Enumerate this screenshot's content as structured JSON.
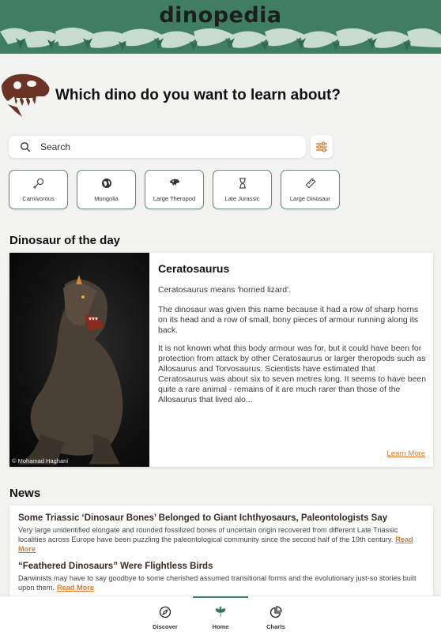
{
  "app": {
    "logo_text": "dinopedia"
  },
  "hero": {
    "title": "Which dino do you want to learn about?"
  },
  "search": {
    "placeholder": "Search",
    "value": ""
  },
  "chips": [
    {
      "label": "Carnivorous",
      "icon": "drumstick-icon"
    },
    {
      "label": "Mongolia",
      "icon": "globe-icon"
    },
    {
      "label": "Large Theropod",
      "icon": "dino-head-icon"
    },
    {
      "label": "Late Jurassic",
      "icon": "hourglass-icon"
    },
    {
      "label": "Large Dinosaur",
      "icon": "ruler-icon"
    }
  ],
  "dino_of_day": {
    "section_title": "Dinosaur of the day",
    "name": "Ceratosaurus",
    "p1": "Ceratosaurus means 'horned lizard'.",
    "p2": "The dinosaur was given this name because it had a row of sharp horns on its head and a row of small, bony pieces of armour running along its back.",
    "p3": "It is not known what this body armour was for, but it could have been for protection from attack by other Ceratosaurus or larger theropods such as Allosaurus and Torvosaurus. Scientists have estimated that Ceratosaurus was about six to seven metres long. It seems to have been quite a rare animal - remains of it are much rarer than those of the Allosaurus that lived alo...",
    "image_credit": "© Mohamad Haghani",
    "learn_more": "Learn More"
  },
  "news": {
    "section_title": "News",
    "items": [
      {
        "headline": "Some Triassic ‘Dinosaur Bones’ Belonged to Giant Ichthyosaurs, Paleontologists Say",
        "text": "Very large unidentified elongate and rounded fossilized bones of uncertain origin recovered from different Late Triassic localities across Europe have been puzzling the paleontological community since the second half of the 19th century.",
        "read_more": "Read More"
      },
      {
        "headline": "“Feathered Dinosaurs” Were Flightless Birds",
        "text": "Darwinists may have to say goodbye to some cherished assumed transitional forms and the evolutionary just-so stories built upon them.",
        "read_more": "Read More"
      }
    ]
  },
  "bottom_nav": [
    {
      "label": "Discover",
      "icon": "compass-icon",
      "active": false
    },
    {
      "label": "Home",
      "icon": "leaf-icon",
      "active": true
    },
    {
      "label": "Charts",
      "icon": "pie-chart-icon",
      "active": false
    }
  ],
  "colors": {
    "brand_green": "#3f7e60",
    "accent_orange": "#d77a2e",
    "skull_brown": "#6b3323"
  }
}
